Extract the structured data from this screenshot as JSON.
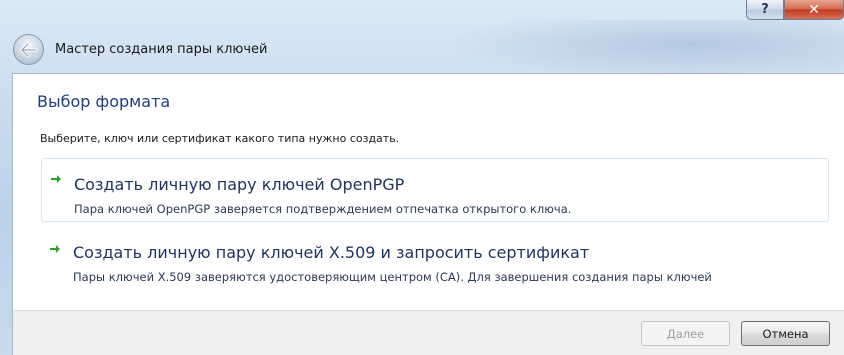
{
  "window": {
    "title": "Мастер создания пары ключей",
    "help_label": "?",
    "close_label": "✕"
  },
  "page": {
    "heading": "Выбор формата",
    "instruction": "Выберите, ключ или сертификат какого типа нужно создать."
  },
  "options": [
    {
      "title": "Создать личную пару ключей OpenPGP",
      "description": "Пара ключей OpenPGP заверяется подтверждением отпечатка открытого ключа."
    },
    {
      "title": "Создать личную пару ключей X.509 и запросить сертификат",
      "description": "Пары ключей X.509 заверяются удостоверяющим центром (CA). Для завершения создания пары ключей"
    }
  ],
  "buttons": {
    "next_label": "Далее",
    "cancel_label": "Отмена"
  },
  "colors": {
    "arrow": "#2ea12e",
    "heading": "#1f3f84"
  },
  "icons": {
    "back": "back-arrow-icon",
    "option_arrow": "green-arrow-icon"
  }
}
